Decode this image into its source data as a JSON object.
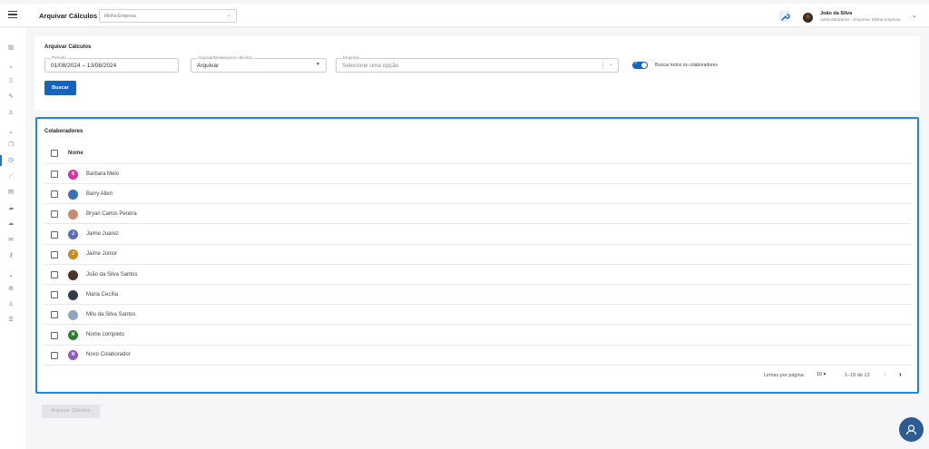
{
  "header": {
    "title": "Arquivar Cálculos",
    "company_select": "Minha Empresa",
    "user_name": "João da Silva",
    "user_role": "Administradores - Empresa: Minha Empresa"
  },
  "filters": {
    "card_title": "Arquivar Cálculos",
    "period_label": "Período",
    "period_value": "01/08/2024 – 13/08/2024",
    "action_label": "Arquivar/Desarquivar cálculos",
    "action_value": "Arquivar",
    "company_label": "Empresa",
    "company_placeholder": "Selecione uma opção",
    "toggle_label": "Buscar todos os colaboradores",
    "toggle_on": true,
    "search_button": "Buscar"
  },
  "collaborators": {
    "title": "Colaboradores",
    "column_name": "Nome",
    "rows": [
      {
        "name": "Barbara Melo",
        "initial": "B",
        "color": "#d6339c"
      },
      {
        "name": "Barry Allen",
        "initial": "",
        "color": "#3b6fb6"
      },
      {
        "name": "Bryan Carlos Pereira",
        "initial": "",
        "color": "#c98b6b"
      },
      {
        "name": "Jaime Juarez",
        "initial": "J",
        "color": "#5c6bc0"
      },
      {
        "name": "Jaime Júnior",
        "initial": "J",
        "color": "#c8891e"
      },
      {
        "name": "João da Silva Santos",
        "initial": "",
        "color": "#4a3526"
      },
      {
        "name": "Maria Cecília",
        "initial": "",
        "color": "#2f3a4a"
      },
      {
        "name": "Milu da Silva Santos",
        "initial": "",
        "color": "#8fa3c4"
      },
      {
        "name": "Nome completo",
        "initial": "N",
        "color": "#2e7d32"
      },
      {
        "name": "Novo Colaborador",
        "initial": "N",
        "color": "#8e5bc2"
      }
    ],
    "pagination": {
      "rows_per_page_label": "Linhas por página:",
      "rows_per_page": "10",
      "range": "1–10 de 13"
    }
  },
  "footer": {
    "archive_button": "Arquivar Cálculos"
  },
  "colors": {
    "primary": "#1565c0",
    "highlight_border": "#1e88e5",
    "fab": "#2f5b95"
  }
}
